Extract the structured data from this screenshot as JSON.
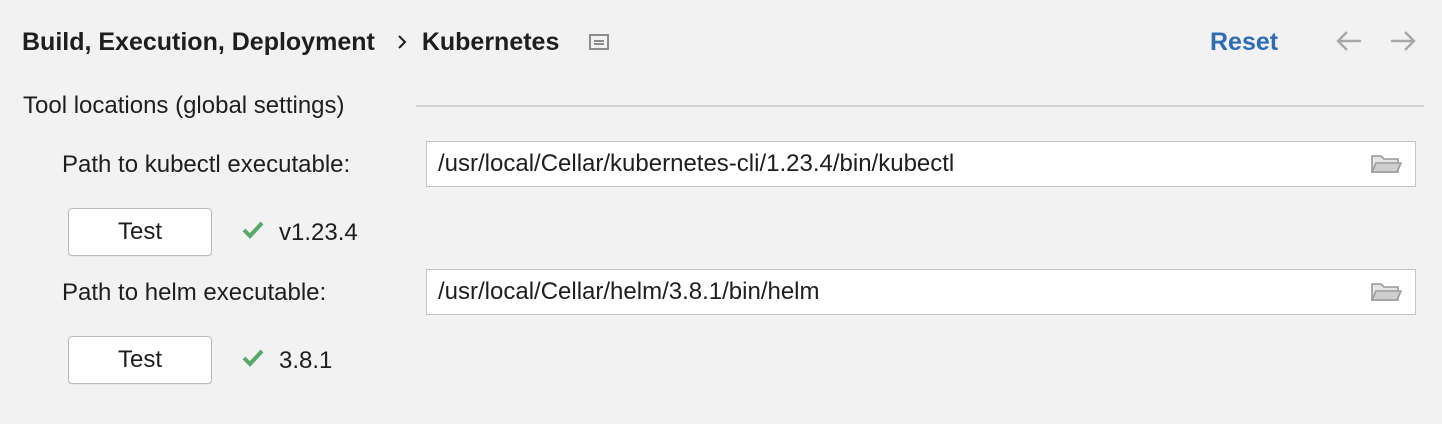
{
  "header": {
    "breadcrumb": [
      "Build, Execution, Deployment",
      "Kubernetes"
    ],
    "reset_label": "Reset"
  },
  "group": {
    "title": "Tool locations (global settings)"
  },
  "kubectl": {
    "label": "Path to kubectl executable:",
    "path": "/usr/local/Cellar/kubernetes-cli/1.23.4/bin/kubectl",
    "test_label": "Test",
    "version": "v1.23.4"
  },
  "helm": {
    "label": "Path to helm executable:",
    "path": "/usr/local/Cellar/helm/3.8.1/bin/helm",
    "test_label": "Test",
    "version": "3.8.1"
  },
  "colors": {
    "accent": "#2f6cb5",
    "success": "#59a869",
    "background": "#f2f2f2"
  },
  "icons": {
    "pin": "pin-icon",
    "back": "arrow-left-icon",
    "forward": "arrow-right-icon",
    "browse": "folder-icon",
    "status": "check-icon"
  }
}
